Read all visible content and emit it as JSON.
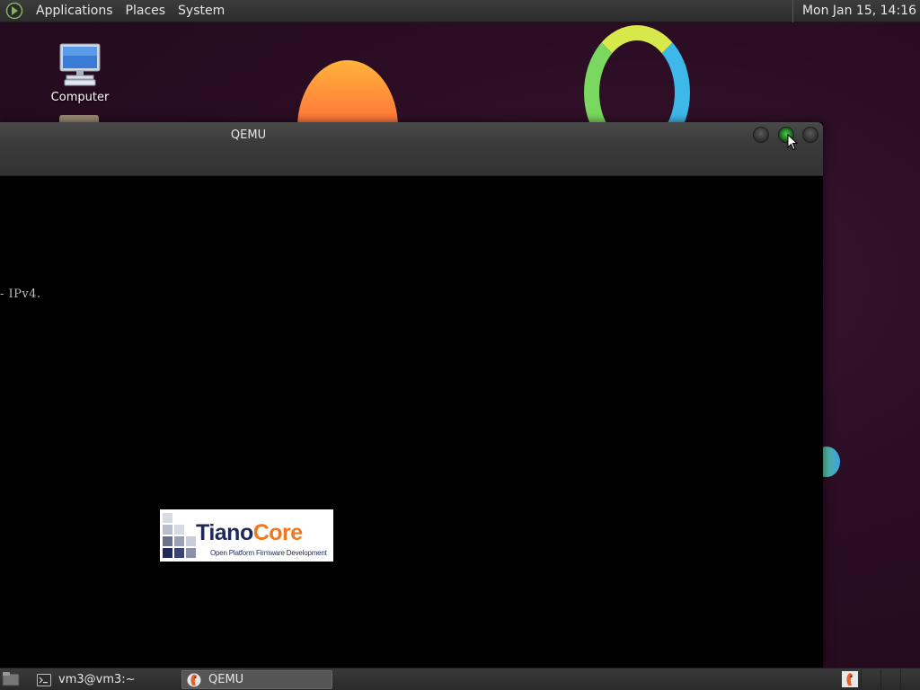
{
  "top_panel": {
    "menus": [
      "Applications",
      "Places",
      "System"
    ],
    "clock": "Mon Jan 15, 14:16"
  },
  "desktop": {
    "icons": [
      {
        "label": "Computer",
        "icon": "computer-icon"
      }
    ]
  },
  "qemu_window": {
    "title": "QEMU",
    "console_line": "- IPv4.",
    "logo": {
      "name_part1": "Tiano",
      "name_part2": "Core",
      "tagline": "Open Platform Firmware Development"
    }
  },
  "bottom_panel": {
    "tasks": [
      {
        "label": "vm3@vm3:~",
        "icon": "terminal-icon",
        "active": false
      },
      {
        "label": "QEMU",
        "icon": "qemu-icon",
        "active": true
      }
    ]
  },
  "colors": {
    "tiano_blue": "#1f2a5a",
    "tiano_orange": "#f0781e"
  }
}
